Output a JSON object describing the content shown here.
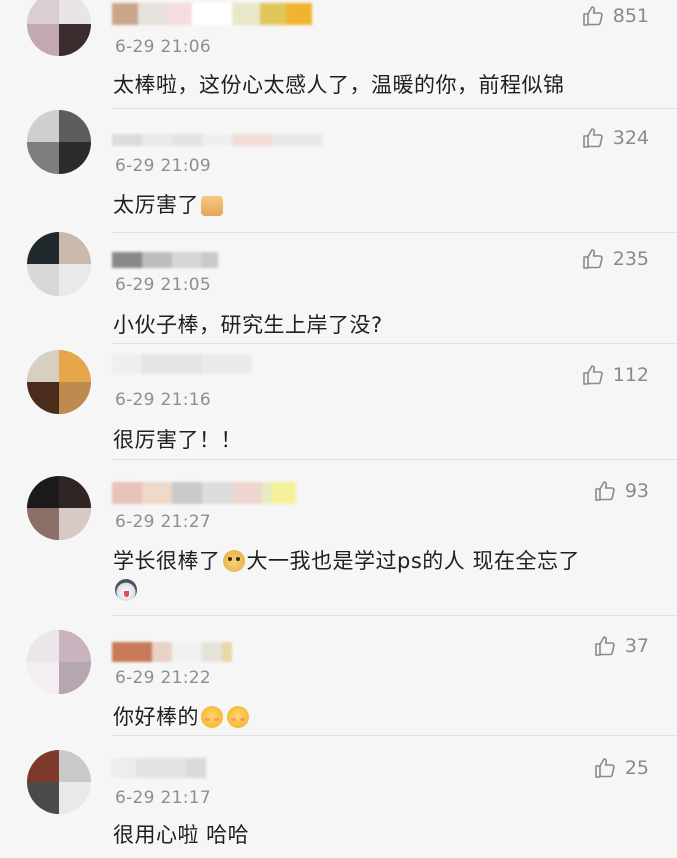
{
  "comments": [
    {
      "time": "6-29 21:06",
      "text": "太棒啦，这份心太感人了，温暖的你，前程似锦",
      "likes": "851",
      "avatar_colors": [
        "#d9cfd3",
        "#e9e4e6",
        "#c4a8b1",
        "#3c2c2e"
      ],
      "name_colors": [
        "#caa58a",
        "#e6e2dc",
        "#f4dde0",
        "#ffffff",
        "#e9e7c9",
        "#e0c75a",
        "#f0b530"
      ]
    },
    {
      "time": "6-29 21:09",
      "text": "太厉害了",
      "emoji_after": "thumbs-up-emoji",
      "likes": "324",
      "avatar_colors": [
        "#cfcfcf",
        "#5d5d5d",
        "#7e7e7e",
        "#2b2b2b"
      ],
      "name_colors": [
        "#dcdcdc",
        "#e9e9e9",
        "#e3e3e3",
        "#eeeeee",
        "#f1dcd8",
        "#e8e8e8"
      ]
    },
    {
      "time": "6-29 21:05",
      "text": "小伙子棒，研究生上岸了没?",
      "likes": "235",
      "avatar_colors": [
        "#1f2a2c",
        "#cbb9ab",
        "#d8d8d8",
        "#e9e9e9"
      ],
      "name_colors": [
        "#8a8a8a",
        "#bdbdbd",
        "#d6d6d6",
        "#c9c9c9"
      ]
    },
    {
      "time": "6-29 21:16",
      "text": "很厉害了！！",
      "likes": "112",
      "avatar_colors": [
        "#d8cfc3",
        "#e7a64a",
        "#4a2c1d",
        "#bf8a4d"
      ],
      "name_colors": [
        "#efefef",
        "#e4e4e4",
        "#eaeaea"
      ]
    },
    {
      "time": "6-29 21:27",
      "text": "学长很棒了",
      "text_after_emoji": "大一我也是学过ps的人 现在全忘了",
      "likes": "93",
      "avatar_colors": [
        "#1b1b1b",
        "#2f2522",
        "#8b6f66",
        "#d8c9c4"
      ],
      "name_colors": [
        "#e7c3b8",
        "#efd9c9",
        "#c9c9c9",
        "#dddddd",
        "#eed5d0",
        "#e9ecbf",
        "#f5f09a"
      ]
    },
    {
      "time": "6-29 21:22",
      "text": "你好棒的",
      "likes": "37",
      "avatar_colors": [
        "#ece6ea",
        "#c8b3bf",
        "#f2eef1",
        "#b6a6b0"
      ],
      "name_colors": [
        "#c87a58",
        "#e9d2c6",
        "#f0f0f0",
        "#e6e3d9",
        "#e8d9a8"
      ]
    },
    {
      "time": "6-29 21:17",
      "text": "很用心啦 哈哈",
      "likes": "25",
      "avatar_colors": [
        "#7d3a2a",
        "#c9c9c9",
        "#4a4a4a",
        "#e9e9e9"
      ],
      "name_colors": [
        "#ededed",
        "#e3e3e3",
        "#d9d9d9"
      ]
    }
  ],
  "icons": {
    "like": "thumbs-up-outline-icon"
  }
}
